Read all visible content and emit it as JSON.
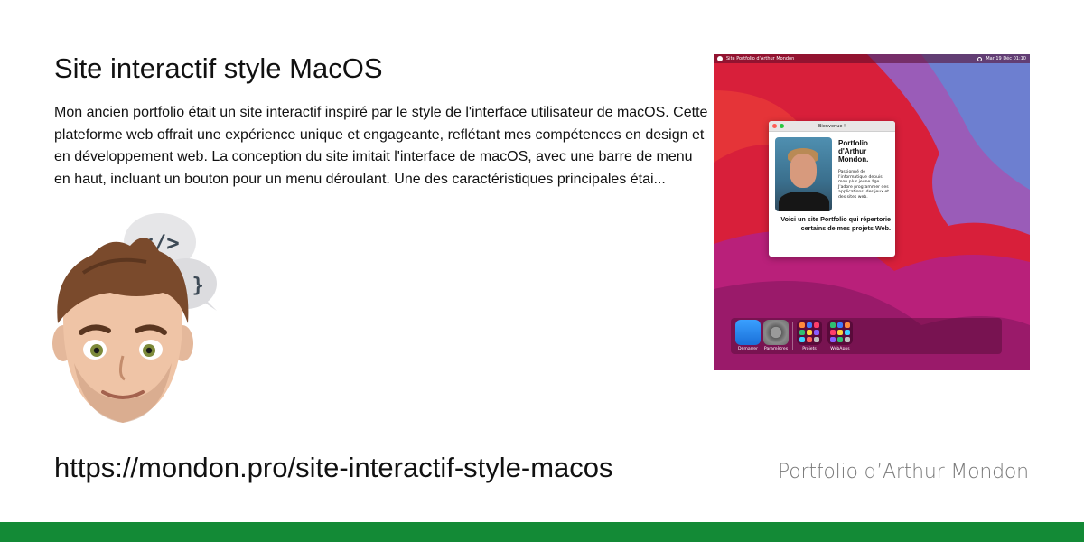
{
  "title": "Site interactif style MacOS",
  "description": "Mon ancien portfolio était un site interactif inspiré par le style de l'interface utilisateur de macOS. Cette plateforme web offrait une expérience unique et engageante, reflétant mes compétences en design et en développement web.    La conception du site imitait l'interface de macOS, avec une barre de menu en haut, incluant un bouton pour un menu déroulant. Une des caractéristiques principales étai...",
  "url": "https://mondon.pro/site-interactif-style-macos",
  "brand": "Portfolio d’Arthur Mondon",
  "colors": {
    "footer": "#138a36",
    "brand_text": "#7a7a7a"
  },
  "screenshot": {
    "menubar": {
      "title": "Site Portfolio d'Arthur Mondon",
      "date": "Mar 19 Déc 01:10"
    },
    "window": {
      "title": "Bienvenue !",
      "heading": "Portfolio d'Arthur Mondon.",
      "body": "Passionné de l'informatique depuis mon plus jeune âge. J'adore programmer des applications, des jeux et des sites web.",
      "footer": "Voici un site Portfolio qui répertorie certains de mes projets Web."
    },
    "dock": [
      "Démarrer",
      "Paramètres",
      "Projets",
      "WebApps"
    ]
  },
  "memoji": {
    "bubble_top": "</>",
    "bubble_bottom": "{ }"
  }
}
